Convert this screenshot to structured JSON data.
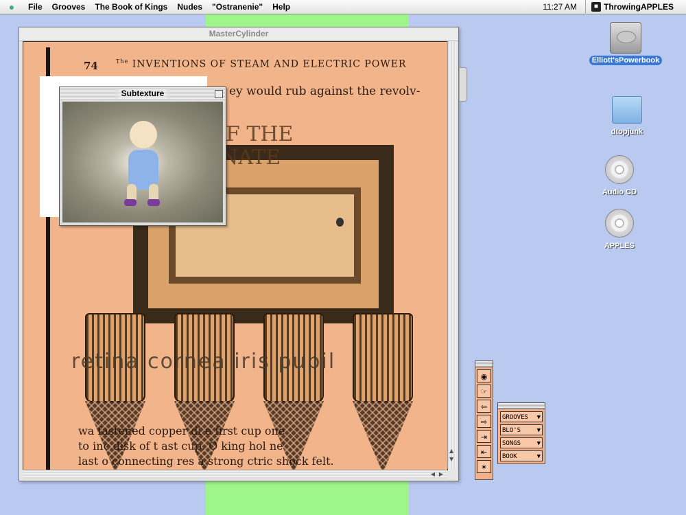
{
  "menubar": {
    "apple_icon": "apple-icon",
    "items": [
      "File",
      "Grooves",
      "The Book of Kings",
      "Nudes",
      "\"Ostranenie\"",
      "Help"
    ],
    "clock": "11:27 AM",
    "app_name": "ThrowingAPPLES"
  },
  "main_window": {
    "title": "MasterCylinder",
    "page": {
      "number": "74",
      "heading_prefix": "The",
      "heading": "INVENTIONS OF STEAM AND ELECTRIC POWER",
      "first_line": "ey would rub against the revolv-",
      "stamp_lines": [
        "ON OF THE",
        "SSIONATE"
      ],
      "overlay_text": "retina cornea iris pupil",
      "bottom_lines": [
        "wa   fastened  copper di    e first cup  one",
        "to  inc disk of t  ast cup.  O  king hol  ne",
        "last  o connecting  res a strong  ctric shock  felt."
      ]
    }
  },
  "subtexture_window": {
    "title": "Subtexture"
  },
  "desktop_icons": [
    {
      "label": "Elliott'sPowerbook",
      "icon": "hard-drive-icon",
      "selected": true
    },
    {
      "label": "dtopjunk",
      "icon": "folder-icon",
      "selected": false
    },
    {
      "label": "Audio CD",
      "icon": "cd-icon",
      "selected": false
    },
    {
      "label": "APPLES",
      "icon": "cd-icon",
      "selected": false
    }
  ],
  "tool_palette": {
    "buttons": [
      "eye-icon",
      "hand-icon",
      "arrow-left-icon",
      "arrow-right-icon",
      "skip-forward-icon",
      "skip-back-icon",
      "star-icon"
    ]
  },
  "menu_palette": {
    "dropdowns": [
      "GROOVES",
      "BLO'S",
      "SONGS",
      "BOOK"
    ]
  },
  "colors": {
    "desktop": "#b9c9ef",
    "green_strip": "#9ef58a",
    "page": "#f2b48a",
    "selection": "#3a78d6"
  }
}
